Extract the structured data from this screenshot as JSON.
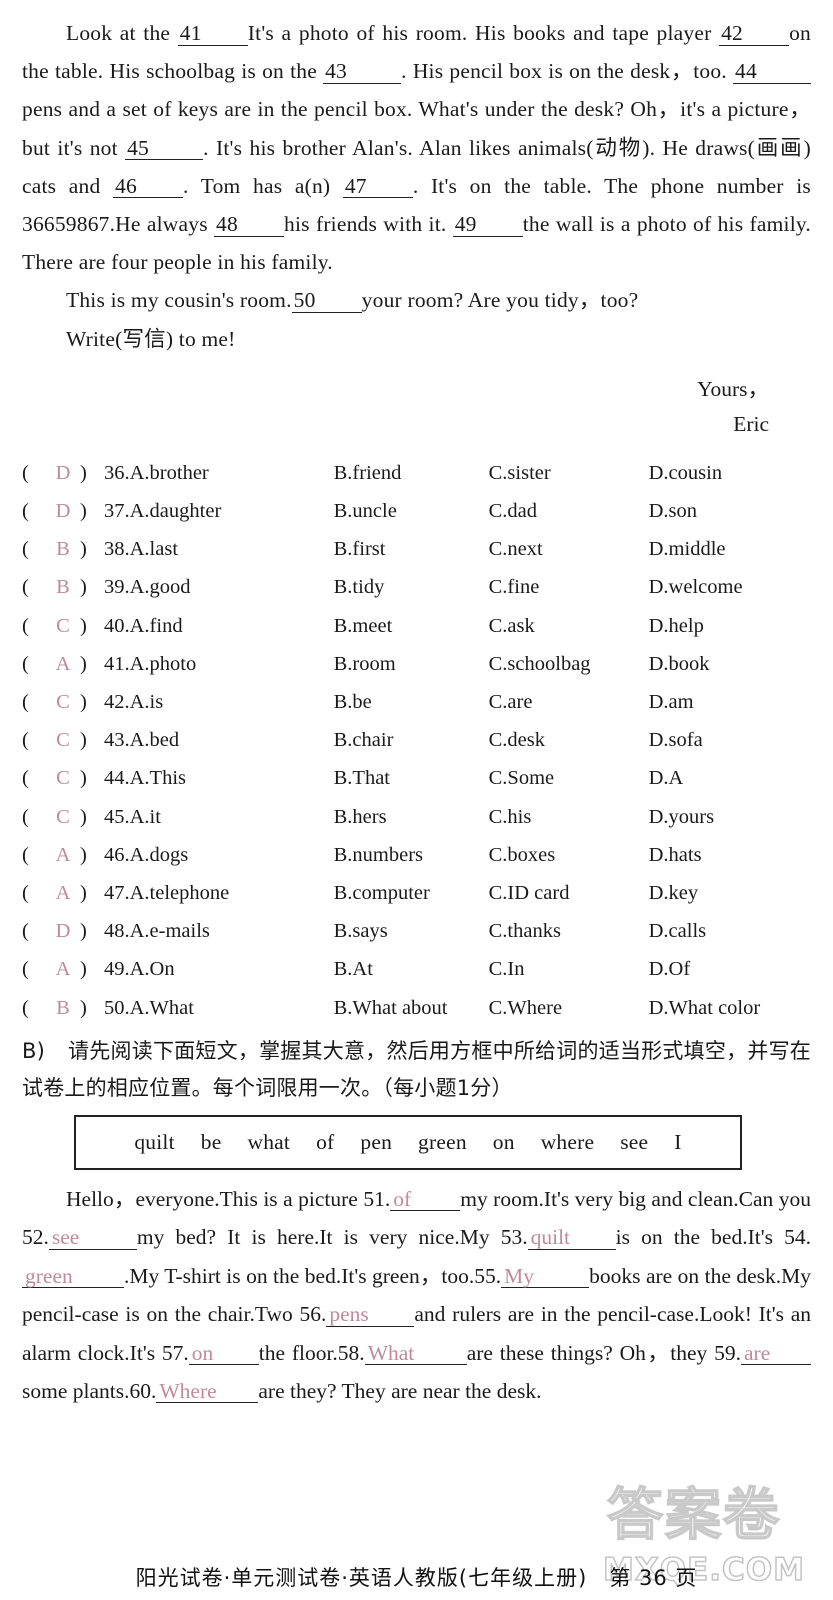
{
  "cloze": {
    "lines": [
      "Look at the ",
      "It's a photo of his room. His books and tape player ",
      "on the table. His schoolbag is on the ",
      ". His pencil box is on the desk，too. ",
      "pens and a set of keys are in the pencil box. What's under the desk? Oh，it's a picture，but it's not ",
      ". It's his brother Alan's. Alan likes animals(动物). He draws(画画) cats and ",
      ". Tom has a(n) ",
      ". It's on the table. The phone number is 36659867.He always ",
      "his friends with it. ",
      "the wall is a photo of his family. There are four people in his family."
    ],
    "blanks": [
      "41",
      "42",
      "43",
      "44",
      "45",
      "46",
      "47",
      "48",
      "49",
      "50"
    ],
    "para2_a": "This is my cousin's room.",
    "para2_b": "your room? Are you tidy，too?",
    "para3": "Write(写信) to me!",
    "signature_1": "Yours，",
    "signature_2": "Eric"
  },
  "mcq": {
    "open_paren": "(",
    "close_paren": ")",
    "answer_color": "#c08a9c",
    "rows": [
      {
        "answer": "D",
        "num": "36.",
        "a": "A.brother",
        "b": "B.friend",
        "c": "C.sister",
        "d": "D.cousin"
      },
      {
        "answer": "D",
        "num": "37.",
        "a": "A.daughter",
        "b": "B.uncle",
        "c": "C.dad",
        "d": "D.son"
      },
      {
        "answer": "B",
        "num": "38.",
        "a": "A.last",
        "b": "B.first",
        "c": "C.next",
        "d": "D.middle"
      },
      {
        "answer": "B",
        "num": "39.",
        "a": "A.good",
        "b": "B.tidy",
        "c": "C.fine",
        "d": "D.welcome"
      },
      {
        "answer": "C",
        "num": "40.",
        "a": "A.find",
        "b": "B.meet",
        "c": "C.ask",
        "d": "D.help"
      },
      {
        "answer": "A",
        "num": "41.",
        "a": "A.photo",
        "b": "B.room",
        "c": "C.schoolbag",
        "d": "D.book"
      },
      {
        "answer": "C",
        "num": "42.",
        "a": "A.is",
        "b": "B.be",
        "c": "C.are",
        "d": "D.am"
      },
      {
        "answer": "C",
        "num": "43.",
        "a": "A.bed",
        "b": "B.chair",
        "c": "C.desk",
        "d": "D.sofa"
      },
      {
        "answer": "C",
        "num": "44.",
        "a": "A.This",
        "b": "B.That",
        "c": "C.Some",
        "d": "D.A"
      },
      {
        "answer": "C",
        "num": "45.",
        "a": "A.it",
        "b": "B.hers",
        "c": "C.his",
        "d": "D.yours"
      },
      {
        "answer": "A",
        "num": "46.",
        "a": "A.dogs",
        "b": "B.numbers",
        "c": "C.boxes",
        "d": "D.hats"
      },
      {
        "answer": "A",
        "num": "47.",
        "a": "A.telephone",
        "b": "B.computer",
        "c": "C.ID card",
        "d": "D.key"
      },
      {
        "answer": "D",
        "num": "48.",
        "a": "A.e-mails",
        "b": "B.says",
        "c": "C.thanks",
        "d": "D.calls"
      },
      {
        "answer": "A",
        "num": "49.",
        "a": "A.On",
        "b": "B.At",
        "c": "C.In",
        "d": "D.Of"
      },
      {
        "answer": "B",
        "num": "50.",
        "a": "A.What",
        "b": "B.What about",
        "c": "C.Where",
        "d": "D.What color"
      }
    ]
  },
  "section_b": {
    "label": "B)",
    "instruction": "请先阅读下面短文，掌握其大意，然后用方框中所给词的适当形式填空，并写在试卷上的相应位置。每个词限用一次。（每小题1分）",
    "wordbox": [
      "quilt",
      "be",
      "what",
      "of",
      "pen",
      "green",
      "on",
      "where",
      "see",
      "I"
    ]
  },
  "fill_passage": {
    "t1": "Hello，everyone.This is a picture 51.",
    "a51": "of",
    "t2": "my room.It's very big and clean.Can you 52.",
    "a52": "see",
    "t3": "my bed? It is here.It is very nice.My 53.",
    "a53": "quilt",
    "t4": "is on the bed.It's 54.",
    "a54": "green",
    "t5": ".My T-shirt is on the bed.It's green，too.55.",
    "a55": "My",
    "t6": "books are on the desk.My pencil-case is on the chair.Two 56.",
    "a56": "pens",
    "t7": "and rulers are in the pencil-case.Look! It's an alarm clock.It's 57.",
    "a57": "on",
    "t8": "the floor.58.",
    "a58": "What",
    "t9": "are these things? Oh，they 59.",
    "a59": "are",
    "t10": "some plants.60.",
    "a60": "Where",
    "t11": "are they? They are near the desk."
  },
  "footer": {
    "text": "阳光试卷·单元测试卷·英语人教版(七年级上册)",
    "page": "第 36 页"
  },
  "watermark": {
    "chinese": "答案卷",
    "url": "MXQE.COM"
  }
}
